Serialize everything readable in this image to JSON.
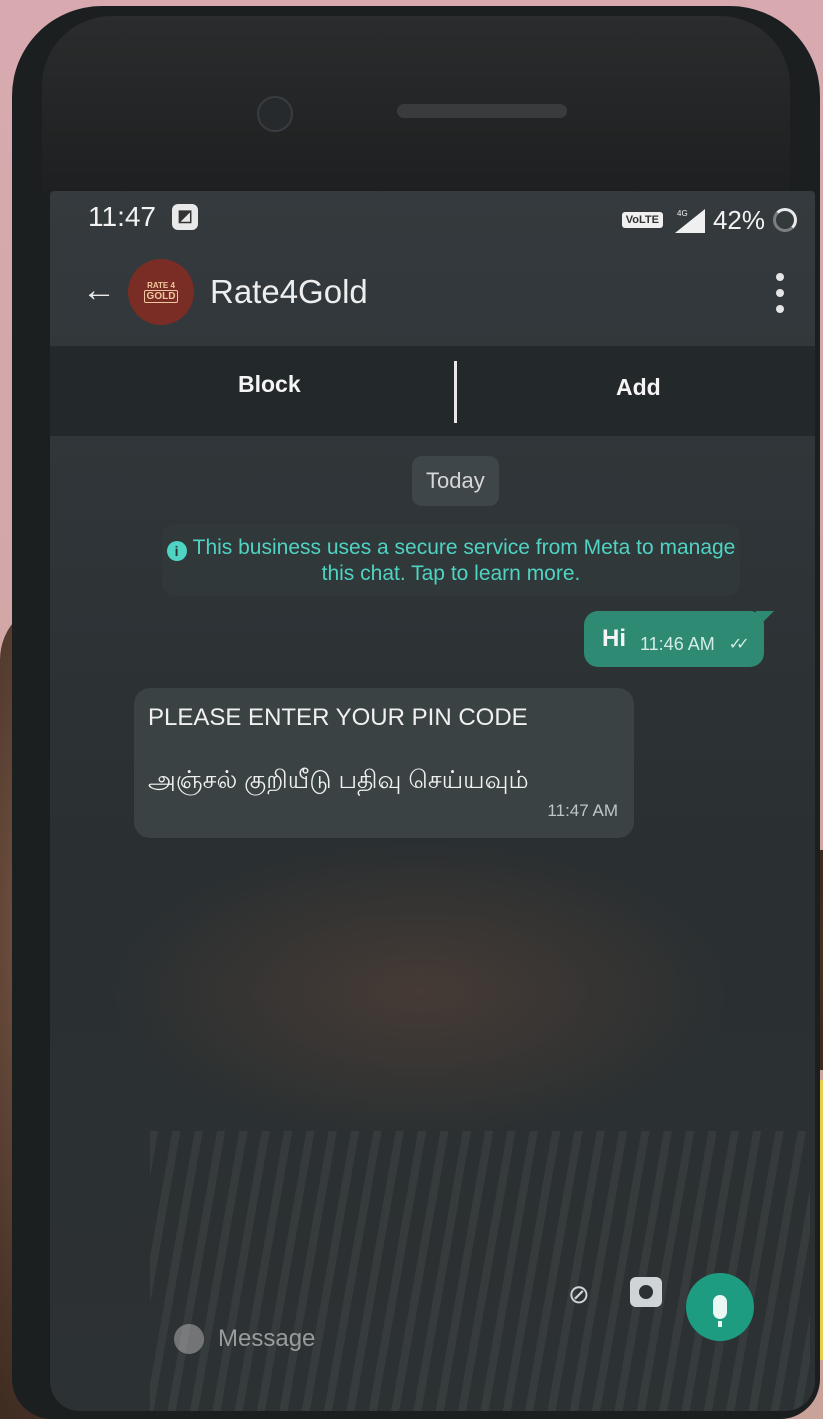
{
  "status_bar": {
    "time": "11:47",
    "network_badge": "VoLTE",
    "network_type": "4G",
    "battery": "42%",
    "icons": [
      "gallery-notification-icon",
      "signal-icon",
      "battery-icon"
    ]
  },
  "app_bar": {
    "title": "Rate4Gold",
    "avatar_text_top": "RATE 4",
    "avatar_text_bottom": "GOLD",
    "icons": [
      "back-arrow-icon",
      "more-vertical-icon"
    ]
  },
  "actions": {
    "block_label": "Block",
    "add_label": "Add"
  },
  "chat": {
    "date_label": "Today",
    "meta_notice": "This business uses a secure service from Meta to manage this chat. Tap to learn more.",
    "messages": [
      {
        "direction": "outgoing",
        "text": "Hi",
        "time": "11:46 AM",
        "status": "read"
      },
      {
        "direction": "incoming",
        "line1": "PLEASE ENTER YOUR PIN CODE",
        "line2": "அஞ்சல் குறியீடு பதிவு செய்யவும்",
        "time": "11:47 AM"
      }
    ]
  },
  "composer": {
    "placeholder": "Message",
    "icons": [
      "emoji-icon",
      "attach-icon",
      "camera-icon",
      "mic-icon"
    ]
  },
  "colors": {
    "accent": "#2f8a73",
    "mic_button": "#1e9c82",
    "notice_text": "#4fd3c3",
    "screen_bg": "#2f3538"
  }
}
